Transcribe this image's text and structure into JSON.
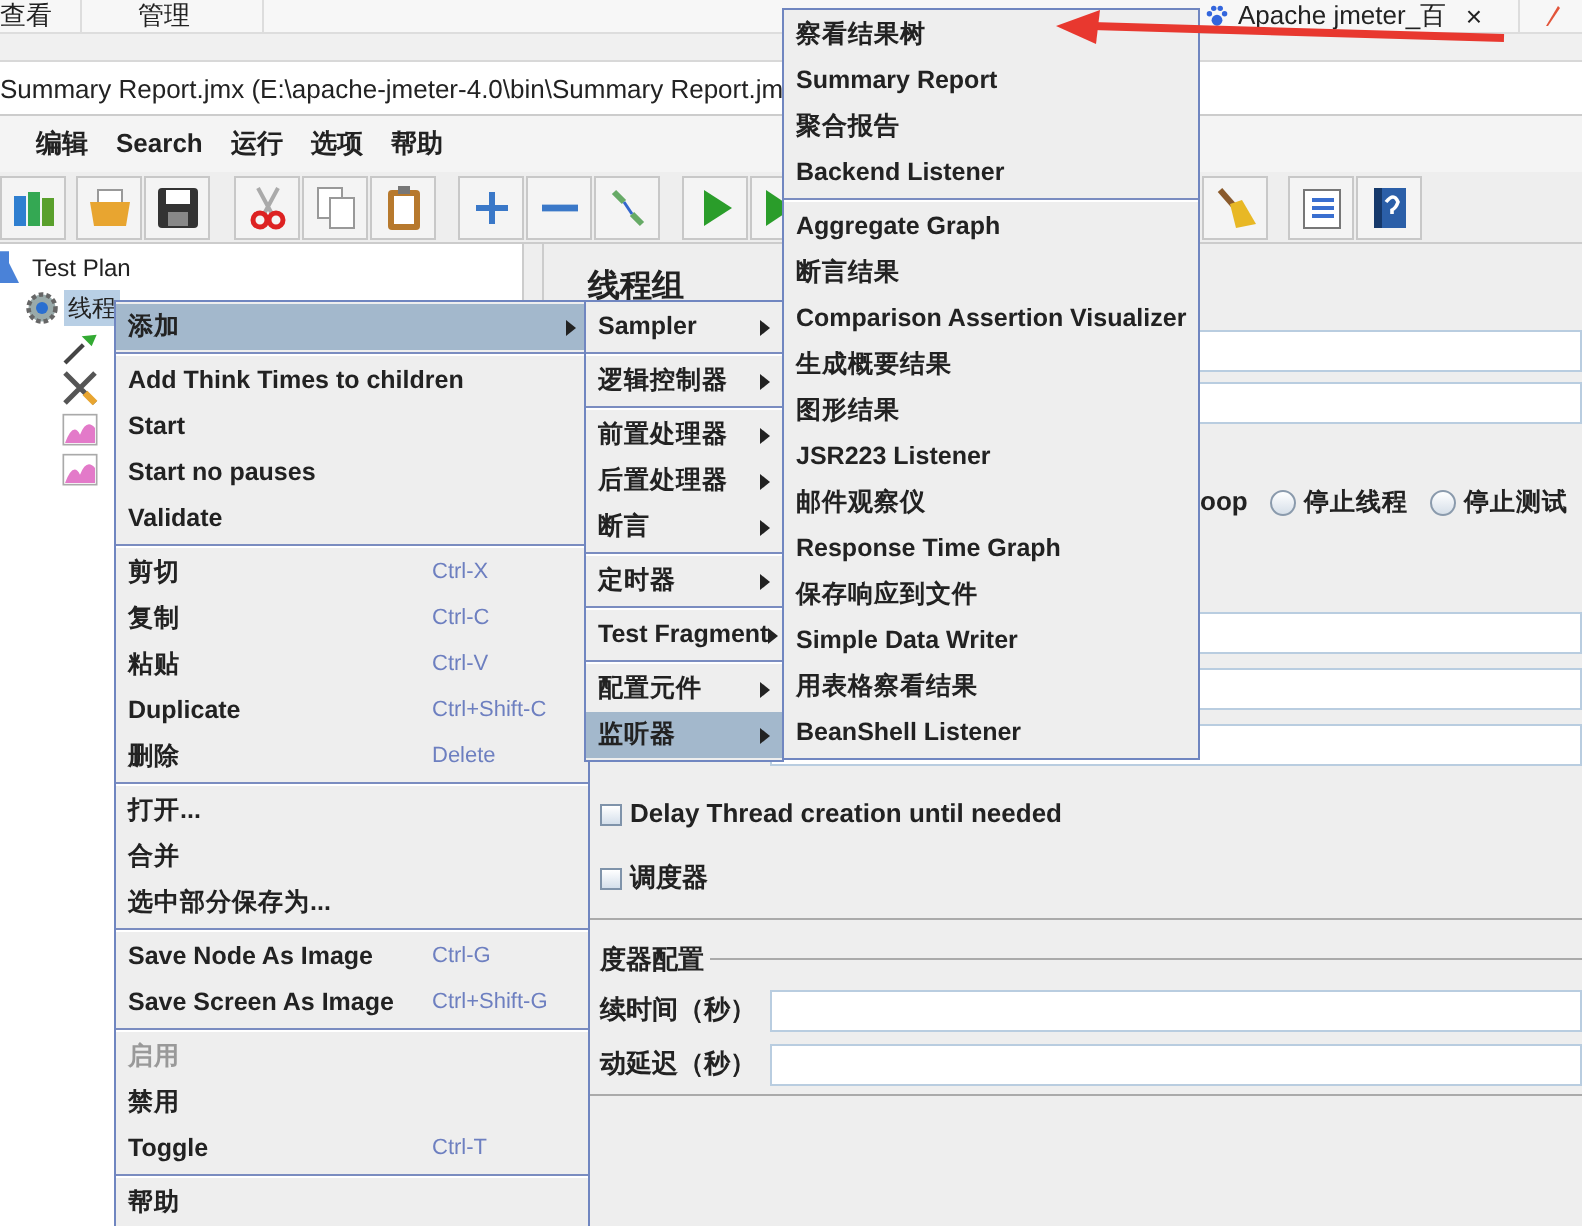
{
  "browser_tabs": [
    {
      "label": "查看"
    },
    {
      "label": "管理"
    }
  ],
  "page_tab": {
    "label": "Apache jmeter_百",
    "close": "×"
  },
  "window": {
    "title": "Summary Report.jmx (E:\\apache-jmeter-4.0\\bin\\Summary Report.jm"
  },
  "menu_bar": [
    {
      "label": "编辑"
    },
    {
      "label": "Search"
    },
    {
      "label": "运行"
    },
    {
      "label": "选项"
    },
    {
      "label": "帮助"
    }
  ],
  "tree": [
    {
      "label": "Test Plan",
      "kind": "plan",
      "selected": false,
      "children": [
        {
          "label": "线程",
          "kind": "thread-group",
          "selected": true,
          "children": [
            {
              "kind": "sampler"
            },
            {
              "kind": "config"
            },
            {
              "kind": "listener"
            },
            {
              "kind": "listener"
            }
          ]
        }
      ]
    }
  ],
  "panel": {
    "heading": "线程组",
    "loop_fragment": "oop",
    "on_error": [
      {
        "label": "停止线程",
        "selected": false
      },
      {
        "label": "停止测试",
        "selected": false
      }
    ],
    "options": [
      {
        "label": "Delay Thread creation until needed",
        "checked": false
      },
      {
        "label": "调度器",
        "checked": false
      }
    ],
    "scheduler": {
      "title": "度器配置",
      "fields": [
        {
          "label": "续时间（秒）"
        },
        {
          "label": "动延迟（秒）"
        }
      ]
    }
  },
  "context_menu": [
    {
      "kind": "item",
      "label": "添加",
      "submenu": true,
      "selected": true,
      "disabled": false
    },
    {
      "kind": "separator"
    },
    {
      "kind": "item",
      "label": "Add Think Times to children",
      "selected": false,
      "disabled": false
    },
    {
      "kind": "item",
      "label": "Start",
      "selected": false,
      "disabled": false
    },
    {
      "kind": "item",
      "label": "Start no pauses",
      "selected": false,
      "disabled": false
    },
    {
      "kind": "item",
      "label": "Validate",
      "selected": false,
      "disabled": false
    },
    {
      "kind": "separator"
    },
    {
      "kind": "item",
      "label": "剪切",
      "shortcut": "Ctrl-X",
      "selected": false,
      "disabled": false
    },
    {
      "kind": "item",
      "label": "复制",
      "shortcut": "Ctrl-C",
      "selected": false,
      "disabled": false
    },
    {
      "kind": "item",
      "label": "粘贴",
      "shortcut": "Ctrl-V",
      "selected": false,
      "disabled": false
    },
    {
      "kind": "item",
      "label": "Duplicate",
      "shortcut": "Ctrl+Shift-C",
      "selected": false,
      "disabled": false
    },
    {
      "kind": "item",
      "label": "删除",
      "shortcut": "Delete",
      "selected": false,
      "disabled": false
    },
    {
      "kind": "separator"
    },
    {
      "kind": "item",
      "label": "打开...",
      "selected": false,
      "disabled": false
    },
    {
      "kind": "item",
      "label": "合并",
      "selected": false,
      "disabled": false
    },
    {
      "kind": "item",
      "label": "选中部分保存为...",
      "selected": false,
      "disabled": false
    },
    {
      "kind": "separator"
    },
    {
      "kind": "item",
      "label": "Save Node As Image",
      "shortcut": "Ctrl-G",
      "selected": false,
      "disabled": false
    },
    {
      "kind": "item",
      "label": "Save Screen As Image",
      "shortcut": "Ctrl+Shift-G",
      "selected": false,
      "disabled": false
    },
    {
      "kind": "separator"
    },
    {
      "kind": "item",
      "label": "启用",
      "selected": false,
      "disabled": true
    },
    {
      "kind": "item",
      "label": "禁用",
      "selected": false,
      "disabled": false
    },
    {
      "kind": "item",
      "label": "Toggle",
      "shortcut": "Ctrl-T",
      "selected": false,
      "disabled": false
    },
    {
      "kind": "separator"
    },
    {
      "kind": "item",
      "label": "帮助",
      "selected": false,
      "disabled": false
    }
  ],
  "add_submenu": [
    {
      "kind": "item",
      "label": "Sampler",
      "submenu": true,
      "selected": false
    },
    {
      "kind": "separator"
    },
    {
      "kind": "item",
      "label": "逻辑控制器",
      "submenu": true,
      "selected": false
    },
    {
      "kind": "separator"
    },
    {
      "kind": "item",
      "label": "前置处理器",
      "submenu": true,
      "selected": false
    },
    {
      "kind": "item",
      "label": "后置处理器",
      "submenu": true,
      "selected": false
    },
    {
      "kind": "item",
      "label": "断言",
      "submenu": true,
      "selected": false
    },
    {
      "kind": "separator"
    },
    {
      "kind": "item",
      "label": "定时器",
      "submenu": true,
      "selected": false
    },
    {
      "kind": "separator"
    },
    {
      "kind": "item",
      "label": "Test Fragment",
      "submenu": true,
      "selected": false
    },
    {
      "kind": "separator"
    },
    {
      "kind": "item",
      "label": "配置元件",
      "submenu": true,
      "selected": false
    },
    {
      "kind": "item",
      "label": "监听器",
      "submenu": true,
      "selected": true
    }
  ],
  "listener_submenu": [
    {
      "kind": "item",
      "label": "察看结果树"
    },
    {
      "kind": "item",
      "label": "Summary Report"
    },
    {
      "kind": "item",
      "label": "聚合报告"
    },
    {
      "kind": "item",
      "label": "Backend Listener"
    },
    {
      "kind": "separator"
    },
    {
      "kind": "item",
      "label": "Aggregate Graph"
    },
    {
      "kind": "item",
      "label": "断言结果"
    },
    {
      "kind": "item",
      "label": "Comparison Assertion Visualizer"
    },
    {
      "kind": "item",
      "label": "生成概要结果"
    },
    {
      "kind": "item",
      "label": "图形结果"
    },
    {
      "kind": "item",
      "label": "JSR223 Listener"
    },
    {
      "kind": "item",
      "label": "邮件观察仪"
    },
    {
      "kind": "item",
      "label": "Response Time Graph"
    },
    {
      "kind": "item",
      "label": "保存响应到文件"
    },
    {
      "kind": "item",
      "label": "Simple Data Writer"
    },
    {
      "kind": "item",
      "label": "用表格察看结果"
    },
    {
      "kind": "item",
      "label": "BeanShell Listener"
    }
  ]
}
